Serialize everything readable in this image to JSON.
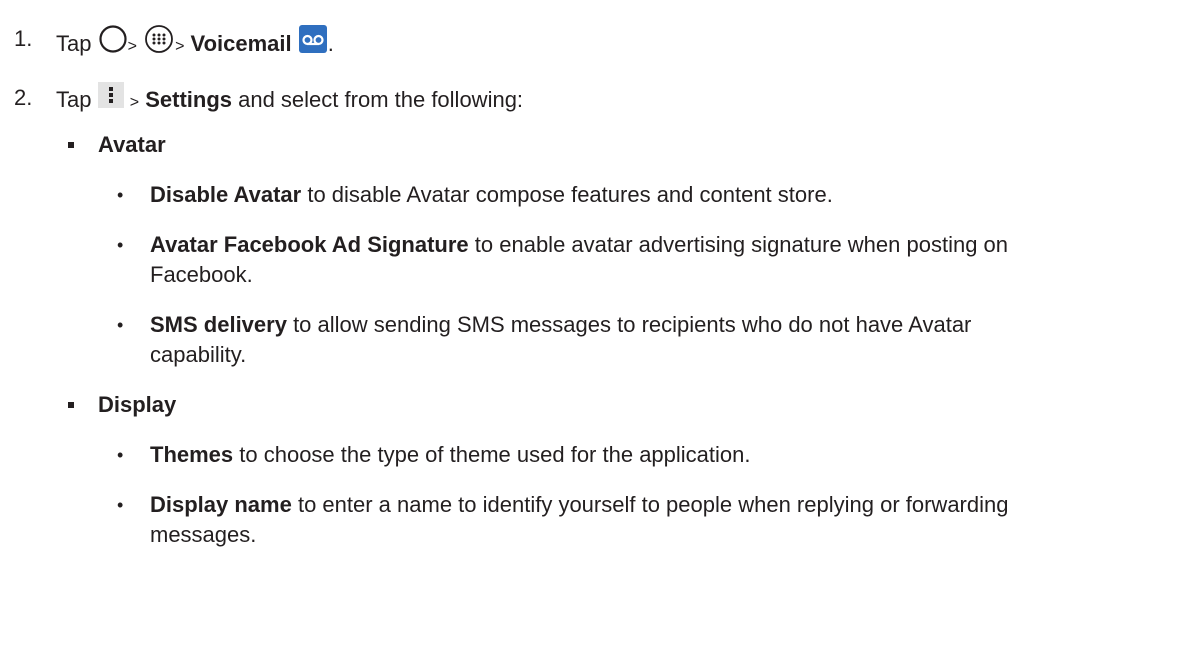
{
  "steps": [
    {
      "number": "1.",
      "tap": "Tap",
      "sep1": ">",
      "sep2": ">",
      "target_bold": "Voicemail",
      "end": ".",
      "icons": [
        "home-circle-icon",
        "apps-grid-icon",
        "voicemail-icon"
      ]
    },
    {
      "number": "2.",
      "tap": "Tap",
      "sep": ">",
      "target_bold": "Settings",
      "rest": " and select from the following:",
      "icons": [
        "menu-dots-icon"
      ]
    }
  ],
  "sections": [
    {
      "title": "Avatar",
      "items": [
        {
          "bold": "Disable Avatar",
          "text": " to disable Avatar compose features and content store."
        },
        {
          "bold": "Avatar Facebook Ad Signature",
          "text": " to enable avatar advertising signature when posting on",
          "text2": "Facebook."
        },
        {
          "bold": "SMS delivery",
          "text": " to allow sending SMS messages to recipients who do not have Avatar",
          "text2": "capability."
        }
      ]
    },
    {
      "title": "Display",
      "items": [
        {
          "bold": "Themes",
          "text": " to choose the type of theme used for the application."
        },
        {
          "bold": "Display name",
          "text": " to enter a name to identify yourself to people when replying or forwarding",
          "text2": "messages."
        }
      ]
    }
  ],
  "colors": {
    "text": "#231f20",
    "voicemail_icon_bg": "#2f6fbf",
    "menu_icon_bg": "#e3e3e3"
  }
}
